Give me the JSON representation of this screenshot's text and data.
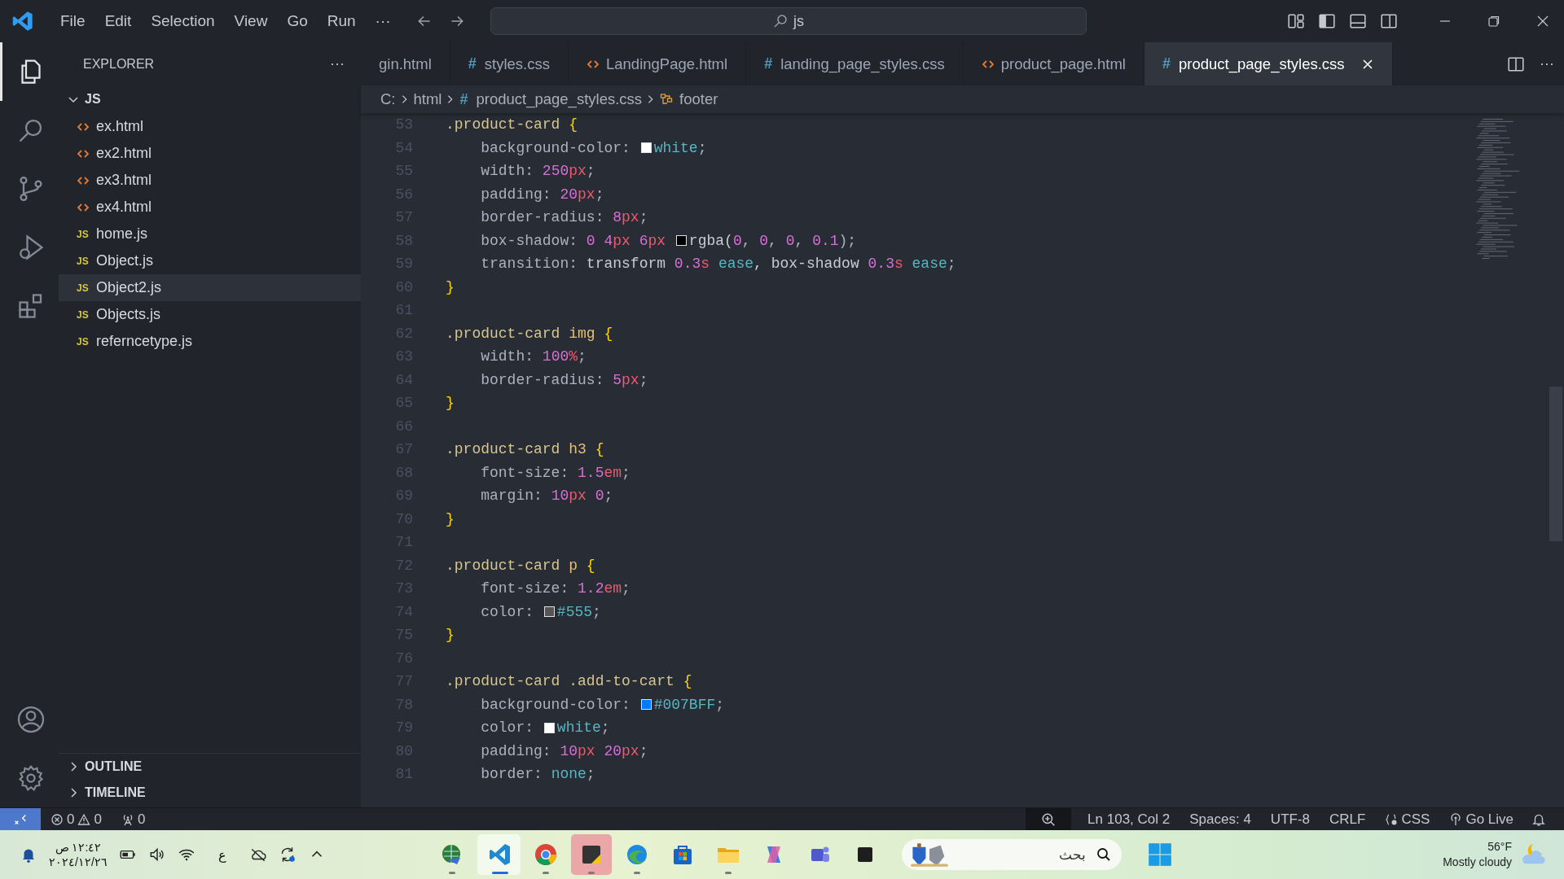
{
  "window": {
    "menu": [
      "File",
      "Edit",
      "Selection",
      "View",
      "Go",
      "Run",
      "···"
    ],
    "search": {
      "value": "js"
    }
  },
  "explorer": {
    "title": "EXPLORER",
    "more": "···",
    "folder": {
      "name": "JS",
      "expanded": true
    },
    "files": [
      {
        "name": "ex.html",
        "kind": "html",
        "selected": false
      },
      {
        "name": "ex2.html",
        "kind": "html",
        "selected": false
      },
      {
        "name": "ex3.html",
        "kind": "html",
        "selected": false
      },
      {
        "name": "ex4.html",
        "kind": "html",
        "selected": false
      },
      {
        "name": "home.js",
        "kind": "js",
        "glyph": "JS",
        "selected": false
      },
      {
        "name": "Object.js",
        "kind": "js",
        "glyph": "JS",
        "selected": false
      },
      {
        "name": "Object2.js",
        "kind": "js",
        "glyph": "JS",
        "selected": true
      },
      {
        "name": "Objects.js",
        "kind": "js",
        "glyph": "JS",
        "selected": false
      },
      {
        "name": "referncetype.js",
        "kind": "js",
        "glyph": "JS",
        "selected": false
      }
    ],
    "sections": [
      {
        "name": "OUTLINE",
        "expanded": false
      },
      {
        "name": "TIMELINE",
        "expanded": false
      }
    ]
  },
  "tabs": [
    {
      "label": "gin.html",
      "kind": "plain",
      "selected": false
    },
    {
      "label": "styles.css",
      "kind": "css",
      "glyph": "#",
      "selected": false
    },
    {
      "label": "LandingPage.html",
      "kind": "html",
      "selected": false
    },
    {
      "label": "landing_page_styles.css",
      "kind": "css",
      "glyph": "#",
      "selected": false
    },
    {
      "label": "product_page.html",
      "kind": "html",
      "selected": false
    },
    {
      "label": "product_page_styles.css",
      "kind": "css",
      "glyph": "#",
      "selected": true
    }
  ],
  "tab_actions": {
    "more": "···"
  },
  "breadcrumb": [
    {
      "label": "C:",
      "kind": "plain"
    },
    {
      "label": "html",
      "kind": "plain"
    },
    {
      "label": "product_page_styles.css",
      "kind": "css",
      "glyph": "#"
    },
    {
      "label": "footer",
      "kind": "symbol"
    }
  ],
  "code": [
    {
      "num": "53",
      "indented": false,
      "tokens": [
        {
          "text": ".product-card ",
          "kind": "sel"
        },
        {
          "text": "{",
          "kind": "brace"
        }
      ]
    },
    {
      "num": "54",
      "indented": true,
      "tokens": [
        {
          "text": "background-color: ",
          "kind": "prop"
        },
        {
          "kind": "swatch",
          "color": "#ffffff"
        },
        {
          "text": "white",
          "kind": "kw"
        },
        {
          "text": ";",
          "kind": "punct"
        }
      ]
    },
    {
      "num": "55",
      "indented": true,
      "tokens": [
        {
          "text": "width: ",
          "kind": "prop"
        },
        {
          "text": "250",
          "kind": "num"
        },
        {
          "text": "px",
          "kind": "unit"
        },
        {
          "text": ";",
          "kind": "punct"
        }
      ]
    },
    {
      "num": "56",
      "indented": true,
      "tokens": [
        {
          "text": "padding: ",
          "kind": "prop"
        },
        {
          "text": "20",
          "kind": "num"
        },
        {
          "text": "px",
          "kind": "unit"
        },
        {
          "text": ";",
          "kind": "punct"
        }
      ]
    },
    {
      "num": "57",
      "indented": true,
      "tokens": [
        {
          "text": "border-radius: ",
          "kind": "prop"
        },
        {
          "text": "8",
          "kind": "num"
        },
        {
          "text": "px",
          "kind": "unit"
        },
        {
          "text": ";",
          "kind": "punct"
        }
      ]
    },
    {
      "num": "58",
      "indented": true,
      "tokens": [
        {
          "text": "box-shadow: ",
          "kind": "prop"
        },
        {
          "text": "0 4",
          "kind": "num"
        },
        {
          "text": "px",
          "kind": "unit"
        },
        {
          "text": " 6",
          "kind": "num"
        },
        {
          "text": "px ",
          "kind": "unit"
        },
        {
          "kind": "swatch",
          "color": "#000000"
        },
        {
          "text": "rgba(",
          "kind": "fn"
        },
        {
          "text": "0",
          "kind": "num"
        },
        {
          "text": ", ",
          "kind": "punct"
        },
        {
          "text": "0",
          "kind": "num"
        },
        {
          "text": ", ",
          "kind": "punct"
        },
        {
          "text": "0",
          "kind": "num"
        },
        {
          "text": ", ",
          "kind": "punct"
        },
        {
          "text": "0.1",
          "kind": "num"
        },
        {
          "text": ");",
          "kind": "punct"
        }
      ]
    },
    {
      "num": "59",
      "indented": true,
      "tokens": [
        {
          "text": "transition: ",
          "kind": "prop"
        },
        {
          "text": "transform ",
          "kind": "fn"
        },
        {
          "text": "0.3",
          "kind": "num"
        },
        {
          "text": "s ",
          "kind": "unit"
        },
        {
          "text": "ease",
          "kind": "kw"
        },
        {
          "text": ", box-shadow ",
          "kind": "fn"
        },
        {
          "text": "0.3",
          "kind": "num"
        },
        {
          "text": "s ",
          "kind": "unit"
        },
        {
          "text": "ease",
          "kind": "kw"
        },
        {
          "text": ";",
          "kind": "punct"
        }
      ]
    },
    {
      "num": "60",
      "indented": false,
      "tokens": [
        {
          "text": "}",
          "kind": "brace"
        }
      ]
    },
    {
      "num": "61"
    },
    {
      "num": "62",
      "indented": false,
      "tokens": [
        {
          "text": ".product-card ",
          "kind": "sel"
        },
        {
          "text": "img ",
          "kind": "tag"
        },
        {
          "text": "{",
          "kind": "brace"
        }
      ]
    },
    {
      "num": "63",
      "indented": true,
      "tokens": [
        {
          "text": "width: ",
          "kind": "prop"
        },
        {
          "text": "100",
          "kind": "num"
        },
        {
          "text": "%",
          "kind": "unit"
        },
        {
          "text": ";",
          "kind": "punct"
        }
      ]
    },
    {
      "num": "64",
      "indented": true,
      "tokens": [
        {
          "text": "border-radius: ",
          "kind": "prop"
        },
        {
          "text": "5",
          "kind": "num"
        },
        {
          "text": "px",
          "kind": "unit"
        },
        {
          "text": ";",
          "kind": "punct"
        }
      ]
    },
    {
      "num": "65",
      "indented": false,
      "tokens": [
        {
          "text": "}",
          "kind": "brace"
        }
      ]
    },
    {
      "num": "66"
    },
    {
      "num": "67",
      "indented": false,
      "tokens": [
        {
          "text": ".product-card ",
          "kind": "sel"
        },
        {
          "text": "h3 ",
          "kind": "tag"
        },
        {
          "text": "{",
          "kind": "brace"
        }
      ]
    },
    {
      "num": "68",
      "indented": true,
      "tokens": [
        {
          "text": "font-size: ",
          "kind": "prop"
        },
        {
          "text": "1.5",
          "kind": "num"
        },
        {
          "text": "em",
          "kind": "unit"
        },
        {
          "text": ";",
          "kind": "punct"
        }
      ]
    },
    {
      "num": "69",
      "indented": true,
      "tokens": [
        {
          "text": "margin: ",
          "kind": "prop"
        },
        {
          "text": "10",
          "kind": "num"
        },
        {
          "text": "px",
          "kind": "unit"
        },
        {
          "text": " 0",
          "kind": "num"
        },
        {
          "text": ";",
          "kind": "punct"
        }
      ]
    },
    {
      "num": "70",
      "indented": false,
      "tokens": [
        {
          "text": "}",
          "kind": "brace"
        }
      ]
    },
    {
      "num": "71"
    },
    {
      "num": "72",
      "indented": false,
      "tokens": [
        {
          "text": ".product-card ",
          "kind": "sel"
        },
        {
          "text": "p ",
          "kind": "tag"
        },
        {
          "text": "{",
          "kind": "brace"
        }
      ]
    },
    {
      "num": "73",
      "indented": true,
      "tokens": [
        {
          "text": "font-size: ",
          "kind": "prop"
        },
        {
          "text": "1.2",
          "kind": "num"
        },
        {
          "text": "em",
          "kind": "unit"
        },
        {
          "text": ";",
          "kind": "punct"
        }
      ]
    },
    {
      "num": "74",
      "indented": true,
      "tokens": [
        {
          "text": "color: ",
          "kind": "prop"
        },
        {
          "kind": "swatch",
          "color": "#555555"
        },
        {
          "text": "#555",
          "kind": "kw"
        },
        {
          "text": ";",
          "kind": "punct"
        }
      ]
    },
    {
      "num": "75",
      "indented": false,
      "tokens": [
        {
          "text": "}",
          "kind": "brace"
        }
      ]
    },
    {
      "num": "76"
    },
    {
      "num": "77",
      "indented": false,
      "tokens": [
        {
          "text": ".product-card .add-to-cart ",
          "kind": "sel"
        },
        {
          "text": "{",
          "kind": "brace"
        }
      ]
    },
    {
      "num": "78",
      "indented": true,
      "tokens": [
        {
          "text": "background-color: ",
          "kind": "prop"
        },
        {
          "kind": "swatch",
          "color": "#007bff"
        },
        {
          "text": "#007BFF",
          "kind": "kw"
        },
        {
          "text": ";",
          "kind": "punct"
        }
      ]
    },
    {
      "num": "79",
      "indented": true,
      "tokens": [
        {
          "text": "color: ",
          "kind": "prop"
        },
        {
          "kind": "swatch",
          "color": "#ffffff"
        },
        {
          "text": "white",
          "kind": "kw"
        },
        {
          "text": ";",
          "kind": "punct"
        }
      ]
    },
    {
      "num": "80",
      "indented": true,
      "tokens": [
        {
          "text": "padding: ",
          "kind": "prop"
        },
        {
          "text": "10",
          "kind": "num"
        },
        {
          "text": "px",
          "kind": "unit"
        },
        {
          "text": " 20",
          "kind": "num"
        },
        {
          "text": "px",
          "kind": "unit"
        },
        {
          "text": ";",
          "kind": "punct"
        }
      ]
    },
    {
      "num": "81",
      "indented": true,
      "tokens": [
        {
          "text": "border: ",
          "kind": "prop"
        },
        {
          "text": "none",
          "kind": "kw"
        },
        {
          "text": ";",
          "kind": "punct"
        }
      ]
    }
  ],
  "status_bar": {
    "errors": "0",
    "warnings": "0",
    "ports": "0",
    "items": [
      {
        "label": "Ln 103, Col 2",
        "kind": "text"
      },
      {
        "label": "Spaces: 4",
        "kind": "text"
      },
      {
        "label": "UTF-8",
        "kind": "text"
      },
      {
        "label": "CRLF",
        "kind": "text"
      },
      {
        "label": "CSS",
        "kind": "language"
      },
      {
        "label": "Go Live",
        "kind": "live"
      }
    ]
  },
  "taskbar": {
    "time": "١٢:٤٢ ص",
    "date": "٢٠٢٤/١٢/٢٦",
    "language": "ع",
    "apps": [
      {
        "kind": "globe",
        "active": false,
        "running": true
      },
      {
        "kind": "code",
        "active": true,
        "running": true
      },
      {
        "kind": "chrome",
        "active": false,
        "running": true
      },
      {
        "kind": "notes",
        "active": false,
        "running": true
      },
      {
        "kind": "edge",
        "active": false,
        "running": true
      },
      {
        "kind": "store",
        "active": false,
        "running": false
      },
      {
        "kind": "folder",
        "active": false,
        "running": true
      },
      {
        "kind": "copilot",
        "active": false,
        "running": false
      },
      {
        "kind": "teams",
        "active": false,
        "running": false
      },
      {
        "kind": "square",
        "active": false,
        "running": false
      }
    ],
    "search": {
      "placeholder": "بحث"
    },
    "weather": {
      "temp": "56°F",
      "text": "Mostly cloudy"
    }
  }
}
